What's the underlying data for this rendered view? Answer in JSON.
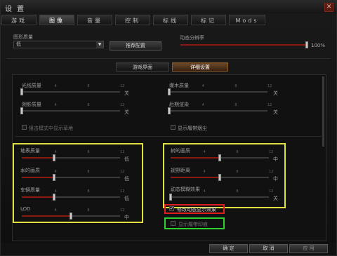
{
  "window": {
    "title": "设 置",
    "close_label": "✕"
  },
  "tabs": [
    {
      "label": "游戏"
    },
    {
      "label": "图像"
    },
    {
      "label": "音量"
    },
    {
      "label": "控制"
    },
    {
      "label": "标线"
    },
    {
      "label": "标记"
    },
    {
      "label": "Mods"
    }
  ],
  "graphics": {
    "quality_label": "图形质量",
    "quality_value": "低",
    "recommend_button": "推荐配置",
    "resolution_label": "动态分辨率",
    "resolution_value": "100%",
    "resolution_level": 1.0
  },
  "subtabs": [
    {
      "label": "游戏界面"
    },
    {
      "label": "详细设置"
    }
  ],
  "upper": {
    "light_quality": {
      "label": "光线质量",
      "end": "关",
      "level": 0.0
    },
    "shadow_quality": {
      "label": "阴影质量",
      "end": "关",
      "level": 0.0
    },
    "shrub_quality": {
      "label": "灌木质量",
      "end": "关",
      "level": 0.0
    },
    "postprocess": {
      "label": "后期渲染",
      "end": "关",
      "level": 0.0
    },
    "sniper_terrain": {
      "label": "狙击模式中显示草地",
      "checked": false
    },
    "track_dust": {
      "label": "显示履带烟尘",
      "checked": false
    }
  },
  "left_group": [
    {
      "label": "地表质量",
      "end": "低",
      "level": 0.33
    },
    {
      "label": "水的画质",
      "end": "低",
      "level": 0.33
    },
    {
      "label": "车辆质量",
      "end": "低",
      "level": 0.33
    },
    {
      "label": "LOD",
      "end": "中",
      "level": 0.5
    }
  ],
  "right_group": [
    {
      "label": "树的画质",
      "end": "中",
      "level": 0.5
    },
    {
      "label": "视野距离",
      "end": "中",
      "level": 0.5
    },
    {
      "label": "动态模糊效果",
      "end": "关",
      "level": 0.0
    }
  ],
  "checkboxes": {
    "fix_dynamic": {
      "label": "修改动态显示效果",
      "checked": true
    },
    "track_marks": {
      "label": "显示履带印痕",
      "checked": false
    }
  },
  "tick_labels": [
    "0",
    "4",
    "8",
    "12"
  ],
  "buttons": {
    "ok": "确 定",
    "cancel": "取 消",
    "apply": "应 用"
  },
  "colors": {
    "accent": "#8a1a10",
    "yellow_box": "#e0e040",
    "red_box": "#e02020",
    "green_box": "#30d030"
  }
}
